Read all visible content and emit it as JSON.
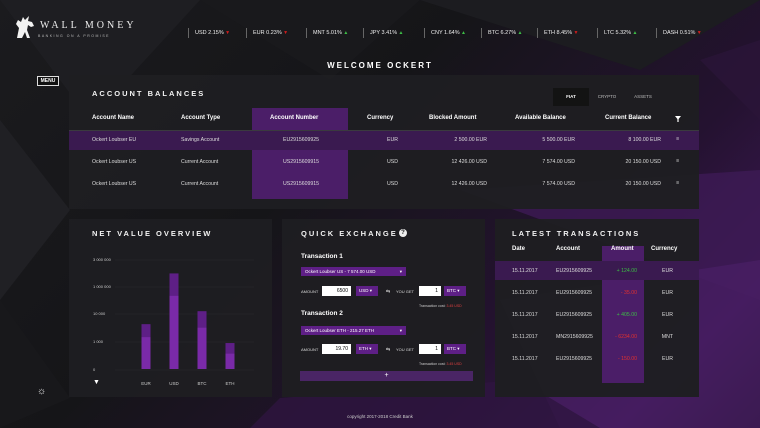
{
  "brand": {
    "name": "WALL MONEY",
    "tagline": "BANKING ON A PROMISE"
  },
  "tickers": [
    {
      "label": "USD 2.15%",
      "dir": "down"
    },
    {
      "label": "EUR 0.23%",
      "dir": "down"
    },
    {
      "label": "MNT 5.01%",
      "dir": "up"
    },
    {
      "label": "JPY 3.41%",
      "dir": "up"
    },
    {
      "label": "CNY 1.64%",
      "dir": "up"
    },
    {
      "label": "BTC 6.27%",
      "dir": "up"
    },
    {
      "label": "ETH 8.45%",
      "dir": "down"
    },
    {
      "label": "LTC 5.32%",
      "dir": "up"
    },
    {
      "label": "DASH 0.51%",
      "dir": "down"
    }
  ],
  "menu_label": "MENU",
  "welcome": "WELCOME OCKERT",
  "balances": {
    "title": "ACCOUNT BALANCES",
    "tabs": [
      "FIAT",
      "CRYPTO",
      "ASSETS"
    ],
    "columns": [
      "Account Name",
      "Account Type",
      "Account Number",
      "Currency",
      "Blocked Amount",
      "Available Balance",
      "Current Balance"
    ],
    "rows": [
      [
        "Ockert Loubser EU",
        "Savings Account",
        "EU2915609925",
        "EUR",
        "2 500.00 EUR",
        "5 500.00 EUR",
        "8 100.00 EUR"
      ],
      [
        "Ockert Loubser US",
        "Current Account",
        "US2915609915",
        "USD",
        "12 426.00 USD",
        "7 574.00 USD",
        "20 150.00 USD"
      ],
      [
        "Ockert Loubser US",
        "Current Account",
        "US2915609915",
        "USD",
        "12 426.00 USD",
        "7 574.00 USD",
        "20 150.00 USD"
      ]
    ]
  },
  "net_value": {
    "title": "NET VALUE OVERVIEW",
    "chart_data": {
      "type": "bar",
      "categories": [
        "EUR",
        "USD",
        "BTC",
        "ETH"
      ],
      "series": [
        {
          "values": [
            0.38,
            0.81,
            0.49,
            0.22
          ]
        },
        {
          "values": [
            0.27,
            0.62,
            0.35,
            0.13
          ]
        }
      ],
      "ytick_labels": [
        "3 000 000",
        "1 000 000",
        "10 000",
        "1 000",
        "0"
      ]
    }
  },
  "quick_exchange": {
    "title": "QUICK EXCHANGE",
    "t1": {
      "title": "Transaction 1",
      "account": "Ockert Loubser US - 7 574.00 USD",
      "amount_label": "AMOUNT",
      "amount": "6500",
      "from": "USD",
      "you_get_label": "YOU GET",
      "get": "1",
      "to": "BTC",
      "cost_label": "Transaction cost:",
      "cost": "3.45 USD"
    },
    "t2": {
      "title": "Transaction 2",
      "account": "Ockert Loubser ETH - 215.27 ETH",
      "amount_label": "AMOUNT",
      "amount": "19.70",
      "from": "ETH",
      "you_get_label": "YOU GET",
      "get": "1",
      "to": "BTC",
      "cost_label": "Transaction cost:",
      "cost": "3.45 USD"
    },
    "add_label": "+"
  },
  "latest": {
    "title": "LATEST TRANSACTIONS",
    "columns": [
      "Date",
      "Account",
      "Amount",
      "Currency"
    ],
    "rows": [
      {
        "date": "15.11.2017",
        "account": "EU2915609925",
        "amount": "+ 124.00",
        "cur": "EUR",
        "color": "#3dbd46"
      },
      {
        "date": "15.11.2017",
        "account": "EU2915609925",
        "amount": "- 35.00",
        "cur": "EUR",
        "color": "#e03030"
      },
      {
        "date": "15.11.2017",
        "account": "EU2915609925",
        "amount": "+ 405.00",
        "cur": "EUR",
        "color": "#3dbd46"
      },
      {
        "date": "15.11.2017",
        "account": "MN2915609925",
        "amount": "- 6234.00",
        "cur": "MNT",
        "color": "#e03030"
      },
      {
        "date": "15.11.2017",
        "account": "EU2915609925",
        "amount": "- 150.00",
        "cur": "EUR",
        "color": "#e03030"
      }
    ]
  },
  "footer": "copyright 2017-2018 Credit Bank",
  "colors": {
    "accent": "#5e1f86",
    "highlight": "#4b1e68"
  }
}
